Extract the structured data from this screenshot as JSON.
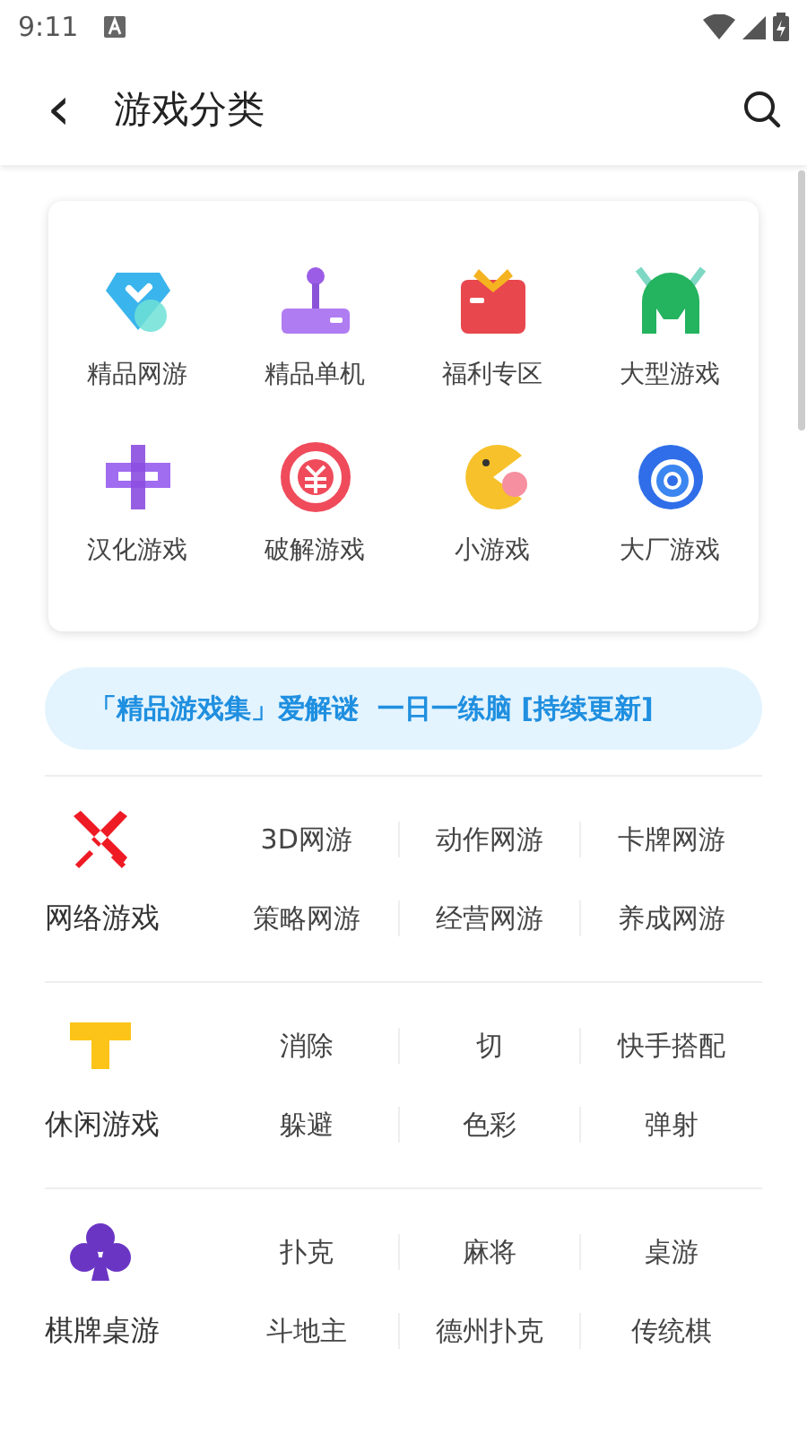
{
  "status_bar": {
    "time": "9:11"
  },
  "header": {
    "back": "‹",
    "title": "游戏分类"
  },
  "categories": [
    {
      "label": "精品网游",
      "kind": "gem"
    },
    {
      "label": "精品单机",
      "kind": "joystick"
    },
    {
      "label": "福利专区",
      "kind": "gift"
    },
    {
      "label": "大型游戏",
      "kind": "helmet"
    },
    {
      "label": "汉化游戏",
      "kind": "hanzi"
    },
    {
      "label": "破解游戏",
      "kind": "coin"
    },
    {
      "label": "小游戏",
      "kind": "pacman"
    },
    {
      "label": "大厂游戏",
      "kind": "swirl"
    }
  ],
  "banner": {
    "text": "「精品游戏集」爱解谜  一日一练脑 [持续更新]"
  },
  "sections": [
    {
      "title": "网络游戏",
      "kind": "swords",
      "tags": [
        "3D网游",
        "动作网游",
        "卡牌网游",
        "策略网游",
        "经营网游",
        "养成网游"
      ]
    },
    {
      "title": "休闲游戏",
      "kind": "block",
      "tags": [
        "消除",
        "切",
        "快手搭配",
        "躲避",
        "色彩",
        "弹射"
      ]
    },
    {
      "title": "棋牌桌游",
      "kind": "club",
      "tags": [
        "扑克",
        "麻将",
        "桌游",
        "斗地主",
        "德州扑克",
        "传统棋"
      ]
    }
  ]
}
